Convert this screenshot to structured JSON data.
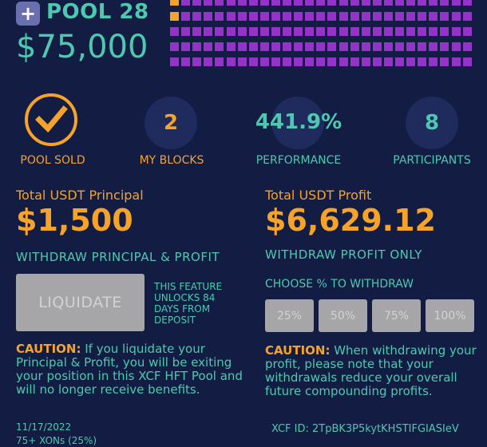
{
  "header": {
    "logo_glyph": "+",
    "pool_name": "POOL 28",
    "pool_amount": "$75,000",
    "block_grid": {
      "columns": 27,
      "rows": 5,
      "orange_blocks": 2
    }
  },
  "stats": {
    "pool_sold_label": "POOL SOLD",
    "my_blocks_value": "2",
    "my_blocks_label": "MY BLOCKS",
    "performance_value": "441.9%",
    "performance_label": "PERFORMANCE",
    "participants_value": "8",
    "participants_label": "PARTICIPANTS"
  },
  "principal": {
    "heading": "Total USDT Principal",
    "amount": "$1,500",
    "withdraw_label": "WITHDRAW PRINCIPAL & PROFIT",
    "liquidate_label": "LIQUIDATE",
    "feature_note": "THIS FEATURE UNLOCKS 84 DAYS FROM DEPOSIT",
    "caution_title": "CAUTION:",
    "caution_text": " If you liquidate your Principal & Profit, you will be exiting your position in this XCF HFT Pool and will no longer receive benefits."
  },
  "profit": {
    "heading": "Total USDT Profit",
    "amount": "$6,629.12",
    "withdraw_label": "WITHDRAW PROFIT ONLY",
    "choose_label": "CHOOSE % TO WITHDRAW",
    "percent_options": [
      "25%",
      "50%",
      "75%",
      "100%"
    ],
    "caution_title": "CAUTION:",
    "caution_text": " When withdrawing your profit, please note that your withdrawals reduce your overall future compounding profits."
  },
  "footer": {
    "date": "11/17/2022",
    "xons": "75+ XONs (25%)",
    "xcf_id": "XCF ID: 2TpBK3P5kytKHSTIFGIASIeV"
  },
  "colors": {
    "background": "#131d43",
    "orange": "#f7a228",
    "teal": "#4ec9b0",
    "purple": "#9333c8",
    "disabled_gray": "#a6a6a8"
  }
}
